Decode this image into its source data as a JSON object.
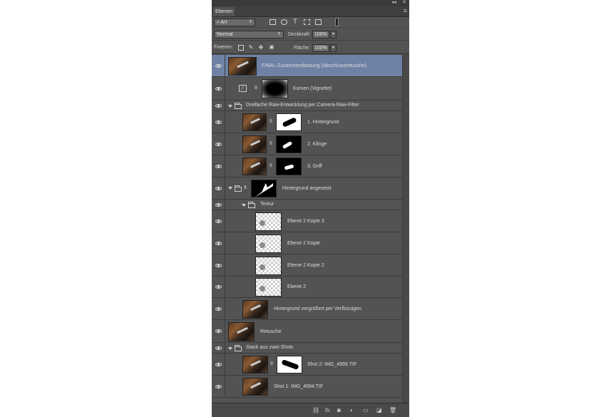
{
  "panel": {
    "tab_label": "Ebenen",
    "top_controls": "◂◂ ✕",
    "menu_icon": "panel-menu-icon"
  },
  "filter": {
    "kind_label": "Art",
    "icons": [
      "image-filter-icon",
      "adjustment-filter-icon",
      "type-filter-icon",
      "shape-filter-icon",
      "smartobject-filter-icon"
    ]
  },
  "blend": {
    "mode": "Normal",
    "opacity_label": "Deckkraft:",
    "opacity_value": "100%"
  },
  "lock": {
    "label": "Fixieren:",
    "fill_label": "Fläche:",
    "fill_value": "100%"
  },
  "layers": [
    {
      "name": "FINAL-Zusammenfassung (Abschlussretusche)"
    },
    {
      "name": "Kurven  (Vignette)"
    },
    {
      "name": "Dreifache Raw-Entwicklung per Camera-Raw-Filter"
    },
    {
      "name": "1. Hintergrund"
    },
    {
      "name": "2. Klinge"
    },
    {
      "name": "3. Griff"
    },
    {
      "name": "Hintergrund angesetzt"
    },
    {
      "name": "Textur"
    },
    {
      "name": "Ebene 2 Kopie 3"
    },
    {
      "name": "Ebene 2 Kopie"
    },
    {
      "name": "Ebene 2 Kopie 2"
    },
    {
      "name": "Ebene 2"
    },
    {
      "name": "Hintergrund vergrößert per Verflüssigen"
    },
    {
      "name": "Retusche"
    },
    {
      "name": "Stack aus zwei Shots"
    },
    {
      "name": "Shot 2: IMG_4999.TIF"
    },
    {
      "name": "Shot 1: IMG_4994.TIF"
    }
  ],
  "bottom_bar": {
    "icons": [
      "link-icon",
      "fx-icon",
      "mask-icon",
      "adjustment-icon",
      "group-icon",
      "new-layer-icon",
      "trash-icon"
    ],
    "fx_label": "fx."
  }
}
